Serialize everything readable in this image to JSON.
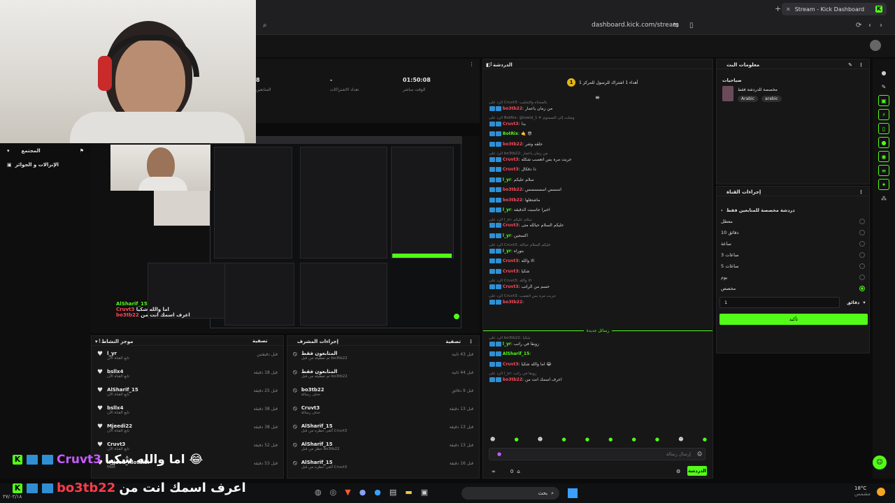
{
  "browser": {
    "tab_title": "Stream - Kick Dashboard",
    "url": "dashboard.kick.com/stream"
  },
  "sidebar": {
    "community": "المجتمع",
    "tasks": "الإنزالات و الجوائز"
  },
  "stats": [
    {
      "value": "01:50:08",
      "label": "الوقت مباشر"
    },
    {
      "value": "-",
      "label": "تعداد الاشتراكات"
    },
    {
      "value": "8",
      "label": "المتابعين"
    }
  ],
  "activity": {
    "title": "موجز النشاط",
    "filter": "تصفية",
    "items": [
      {
        "name": "l_yr",
        "sub": "تابع القناة الآن",
        "time": "قبل دقيقتين"
      },
      {
        "name": "bsllx4",
        "sub": "تابع القناة الآن",
        "time": "قبل 18 دقيقة"
      },
      {
        "name": "AlSharif_15",
        "sub": "تابع القناة الآن",
        "time": "قبل 25 دقيقة"
      },
      {
        "name": "bsllx4",
        "sub": "تابع القناة الآن",
        "time": "قبل 38 دقيقة"
      },
      {
        "name": "Mjeedi22",
        "sub": "تابع القناة الآن",
        "time": "قبل 38 دقيقة"
      },
      {
        "name": "Cruvt3",
        "sub": "تابع القناة الآن",
        "time": "قبل 52 دقيقة"
      },
      {
        "name": "iMjeed_Alotaibi",
        "sub": "Mod",
        "time": "قبل 53 دقيقة"
      }
    ]
  },
  "modlog": {
    "title": "إجراءات المشرف",
    "filter": "تصفية",
    "items": [
      {
        "name": "المتابعون فقط",
        "sub": "تم تعطيله من قبل bo3tb22",
        "time": "قبل 43 ثانية"
      },
      {
        "name": "المتابعون فقط",
        "sub": "تم تعطيله من قبل bo3tb22",
        "time": "قبل 44 ثانية"
      },
      {
        "name": "bo3tb22",
        "sub": "حذف رسالة",
        "time": "قبل 9 دقائق"
      },
      {
        "name": "Cruvt3",
        "sub": "حذف رسالة",
        "time": "قبل 13 دقيقة"
      },
      {
        "name": "AlSharif_15",
        "sub": "ألغى حظره من قبل Cruvt3",
        "time": "قبل 13 دقيقة"
      },
      {
        "name": "AlSharif_15",
        "sub": "حظر من قبل bo3tb22",
        "time": "قبل 13 دقيقة"
      },
      {
        "name": "AlSharif_15",
        "sub": "ألغى حظره من قبل Cruvt3",
        "time": "قبل 16 دقيقة"
      }
    ]
  },
  "chat": {
    "title": "الدردشة",
    "pinned": "أهداء 1 اشتراك للرسول للمركز 1",
    "pinned_rank": "1",
    "messages": [
      {
        "reply": "الرد على Cruvt3: بالمحتاه والتخليب",
        "user": "bo3tb22",
        "text": "من زمان ياعمار",
        "color": "red"
      },
      {
        "reply": "الرد على BotRix: @lowid_1 4 وصلت إلى المستوى",
        "user": "Cruvt3",
        "text": "يدا",
        "color": "red"
      },
      {
        "reply": "",
        "user": "BotRix",
        "text": "🤙 😎",
        "color": "green"
      },
      {
        "reply": "",
        "user": "bo3tb22",
        "text": "حلقه وشر",
        "color": "red"
      },
      {
        "reply": "الرد على bo3tb22: من زمان ياعمار",
        "user": "Cruvt3",
        "text": "جربت مره بس اتعصب شكله",
        "color": "red"
      },
      {
        "reply": "",
        "user": "Cruvt3",
        "text": "ذا دقكال",
        "color": "red"
      },
      {
        "reply": "",
        "user": "l_yr",
        "text": "سلام عليكم",
        "color": "green"
      },
      {
        "reply": "",
        "user": "bo3tb22",
        "text": "اسسس اسسسسس",
        "color": "red"
      },
      {
        "reply": "",
        "user": "bo3tb22",
        "text": "ماشتغلها",
        "color": "red"
      },
      {
        "reply": "",
        "user": "l_yr",
        "text": "اخيراً جاسبت الدقيقه",
        "color": "green"
      },
      {
        "reply": "الرد على l_yr: سلام عليكم",
        "user": "Cruvt3",
        "text": "عليكم السلام حيالله متى",
        "color": "red"
      },
      {
        "reply": "",
        "user": "l_yr",
        "text": "اكسجين",
        "color": "green"
      },
      {
        "reply": "الرد على Cruvt3: عليكم السلام حيالله",
        "user": "l_yr",
        "text": "بتوراه",
        "color": "green"
      },
      {
        "reply": "",
        "user": "Cruvt3",
        "text": "الا والله",
        "color": "red"
      },
      {
        "reply": "",
        "user": "Cruvt3",
        "text": "شكيا",
        "color": "red"
      },
      {
        "reply": "الرد على Cruvt3: الا والله",
        "user": "Cruvt3",
        "text": "حسم من الراتب",
        "color": "red"
      },
      {
        "reply": "الرد على Cruvt3: جربت مره بس اتعصب",
        "user": "bo3tb22",
        "text": "",
        "color": "red"
      }
    ],
    "new_messages": "رسائل جديدة",
    "messages2": [
      {
        "reply": "الرد على bo3tb22: شكيا",
        "user": "l_yr",
        "text": "زوبقا في راتب",
        "color": "green"
      },
      {
        "reply": "",
        "user": "AlSharif_15",
        "text": "",
        "color": "green"
      },
      {
        "reply": "",
        "user": "Cruvt3",
        "text": "اما والله شكيا 😂",
        "color": "red"
      },
      {
        "reply": "الرد على l_yr: زوبقا في راتب",
        "user": "bo3tb22",
        "text": "اعرف اسمك انت من",
        "color": "red"
      }
    ],
    "input_placeholder": "إرسال رسالة",
    "send_label": "الدردشة",
    "viewer_count": "0"
  },
  "about": {
    "title": "معلومات البث",
    "section": "صياحيات",
    "subtitle": "مخصصة للدردشة فقط",
    "tags": [
      "Arabic",
      "arabic"
    ]
  },
  "channel_actions": {
    "title": "إجراءات القناة",
    "subtitle": "دردشة مخصصة للمتابعين فقط",
    "options": [
      "معطل",
      "10 دقائق",
      "ساعة",
      "3 ساعات",
      "5 ساعات",
      "يوم",
      "مخصص"
    ],
    "selected_index": 6,
    "duration_value": "1",
    "duration_unit": "دقائق",
    "confirm_label": "تأكيد"
  },
  "overlay": {
    "line1_user": "Cruvt3",
    "line1_text": "اما والله شكيا 😂",
    "line2_user": "bo3tb22",
    "line2_text": "اعرف اسمك انت من"
  },
  "preview": {
    "chat_user1": "AlSharif_15",
    "chat_user2": "Cruvt3",
    "chat_text2": "اما والله شكيا",
    "chat_user3": "bo3tb22",
    "chat_text3": "اعرف اسمك انت من"
  },
  "taskbar": {
    "search": "بحث",
    "temp": "18°C",
    "weather": "مشمس",
    "clock": "٢٧/٠٢/١٨"
  }
}
